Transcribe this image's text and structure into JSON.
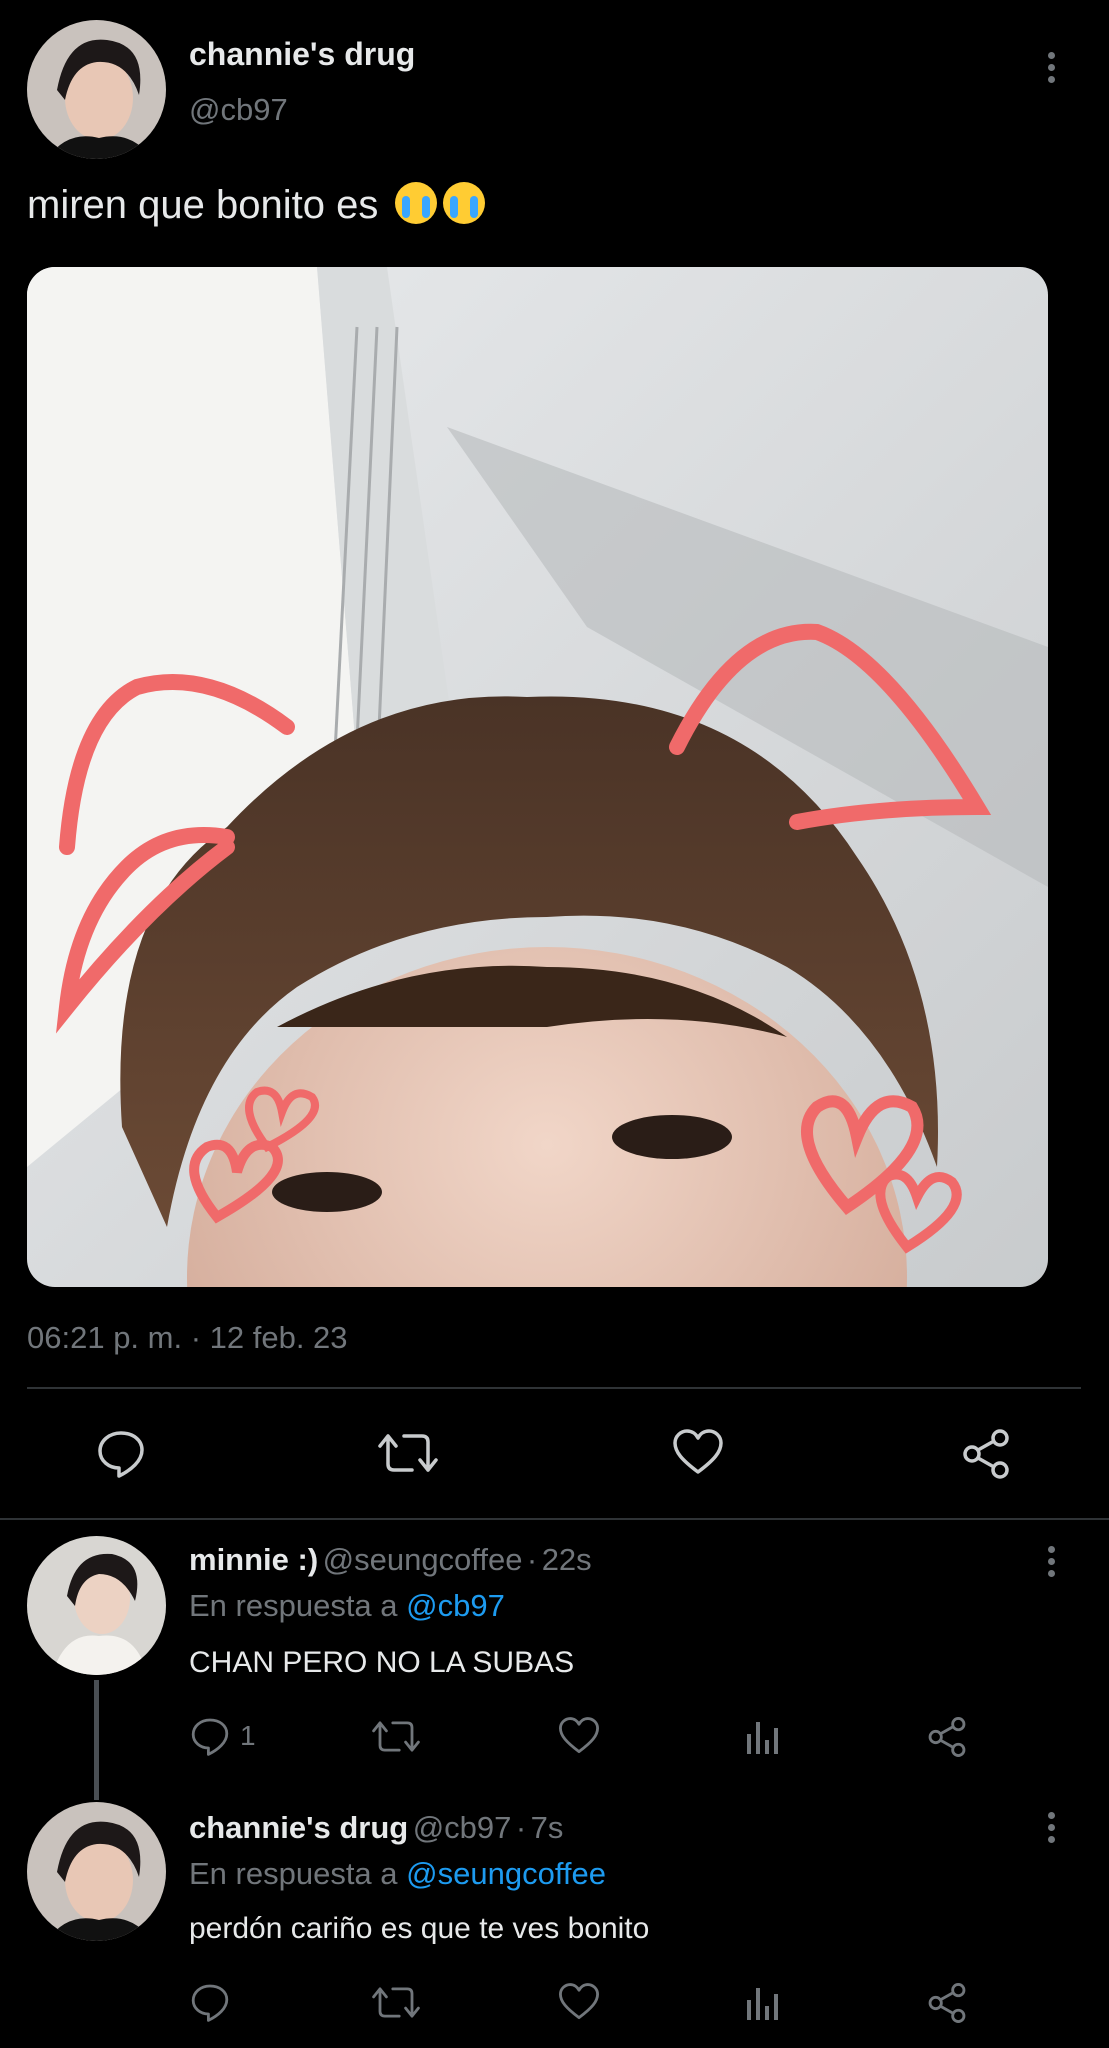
{
  "tweet": {
    "author_name": "channie's drug",
    "author_handle": "@cb97",
    "text": "miren que bonito es",
    "emoji_names": [
      "loudly-crying-face-icon",
      "loudly-crying-face-icon"
    ],
    "timestamp": "06:21 p. m. · 12 feb. 23"
  },
  "replies": [
    {
      "name": "minnie :)",
      "handle": "@seungcoffee",
      "sep": "·",
      "time": "22s",
      "in_reply_prefix": "En respuesta a",
      "in_reply_to": "@cb97",
      "text": "CHAN PERO NO LA SUBAS",
      "reply_count": "1"
    },
    {
      "name": "channie's drug",
      "handle": "@cb97",
      "sep": "·",
      "time": "7s",
      "in_reply_prefix": "En respuesta a",
      "in_reply_to": "@seungcoffee",
      "text": "perdón cariño es que te ves bonito",
      "reply_count": ""
    }
  ],
  "colors": {
    "background": "#000000",
    "text": "#e7e9ea",
    "muted": "#71767b",
    "link": "#1d9bf0",
    "doodle": "#f06a6a"
  }
}
